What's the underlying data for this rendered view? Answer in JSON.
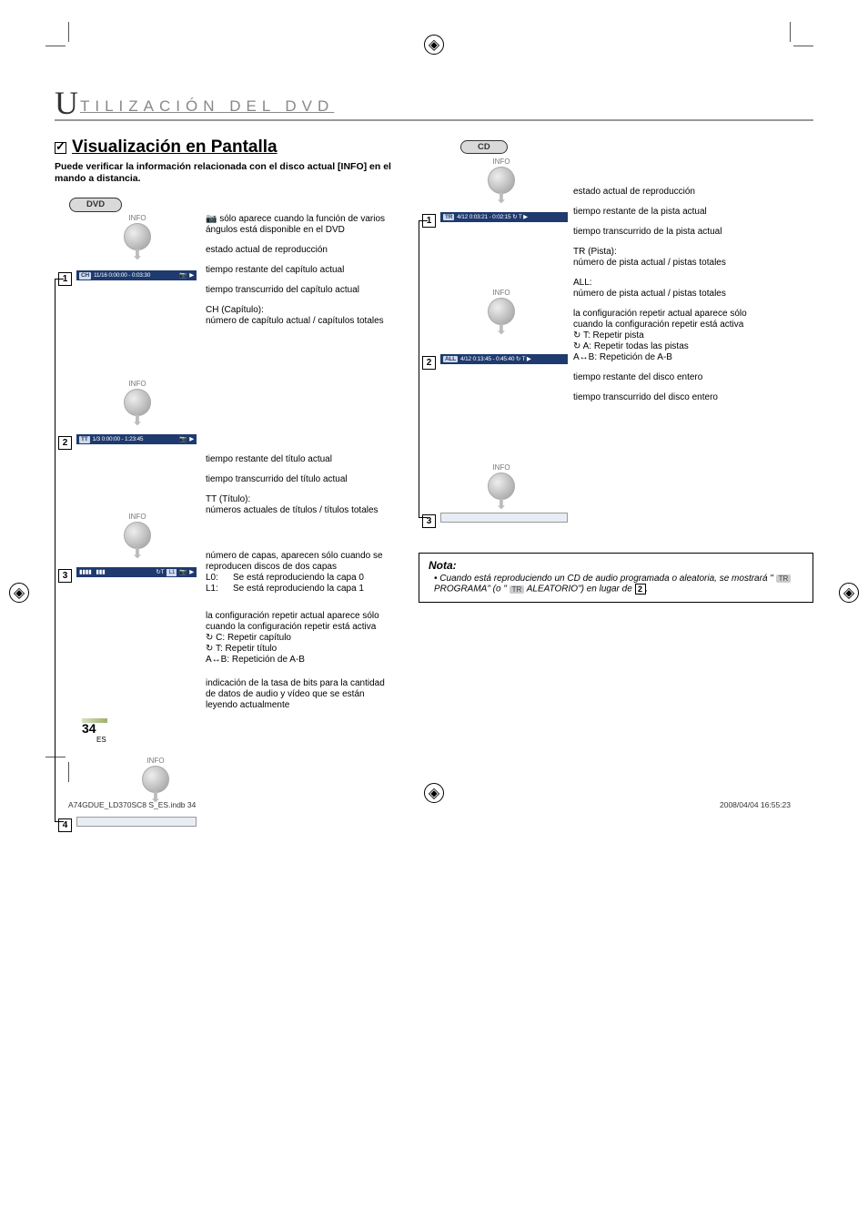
{
  "section_title_first": "U",
  "section_title_rest": "TILIZACIÓN   DEL   DVD",
  "subsection": "Visualización en Pantalla",
  "intro_pre": "Puede verificar la información relacionada con el disco actual ",
  "intro_key": "[INFO]",
  "intro_post": " en el mando a distancia.",
  "dvd_label": "DVD",
  "cd_label": "CD",
  "info_label": "INFO",
  "dvd": {
    "osd1": {
      "tag": "CH",
      "text": "11/16  0:00:00  -  0:03:30"
    },
    "osd2": {
      "tag": "TT",
      "text": "1/3   0:00:00  -  1:23:45"
    },
    "c_angle": "sólo aparece cuando la función de varios ángulos está disponible en el DVD",
    "c_status": "estado actual de reproducción",
    "c_ch_remain": "tiempo restante del capítulo actual",
    "c_ch_elapsed": "tiempo transcurrido del capítulo actual",
    "c_ch_title": "CH (Capítulo):",
    "c_ch_body": "número de capítulo actual / capítulos totales",
    "c_tt_remain": "tiempo restante del título actual",
    "c_tt_elapsed": "tiempo transcurrido del título actual",
    "c_tt_title": "TT (Título):",
    "c_tt_body": "números actuales de títulos / títulos totales",
    "c_layer_head": "número de capas, aparecen sólo cuando se reproducen discos de dos capas",
    "c_layer_l0k": "L0:",
    "c_layer_l0v": "Se está reproduciendo la capa 0",
    "c_layer_l1k": "L1:",
    "c_layer_l1v": "Se está reproduciendo la capa 1",
    "c_repeat_head": "la configuración repetir actual aparece sólo cuando la configuración repetir está activa",
    "c_repeat_c": "C:   Repetir capítulo",
    "c_repeat_t": "T:   Repetir título",
    "c_repeat_ab": "A↔B: Repetición de A-B",
    "c_bitrate": "indicación de la tasa de bits para la cantidad de datos de audio y vídeo que se están leyendo actualmente"
  },
  "cd": {
    "osd1": {
      "tag": "TR",
      "text": "4/12  0:03:21  -  0:02:15  ↻ T  ▶"
    },
    "osd2": {
      "tag": "ALL",
      "text": "4/12  0:13:45  -  0:45:40  ↻ T  ▶"
    },
    "c_status": "estado actual de reproducción",
    "c_tr_remain": "tiempo restante de la pista actual",
    "c_tr_elapsed": "tiempo transcurrido de la pista actual",
    "c_tr_title": "TR (Pista):",
    "c_tr_body": "número de pista actual / pistas totales",
    "c_all_title": "ALL:",
    "c_all_body": "número de pista actual / pistas totales",
    "c_repeat_head": "la configuración repetir actual aparece sólo cuando la configuración repetir está activa",
    "c_repeat_t": "T:   Repetir pista",
    "c_repeat_a": "A:   Repetir todas las pistas",
    "c_repeat_ab": "A↔B: Repetición de A-B",
    "c_disc_remain": "tiempo restante del disco entero",
    "c_disc_elapsed": "tiempo transcurrido del disco entero"
  },
  "note_title": "Nota:",
  "note_body_1": "Cuando está reproduciendo un CD de audio programada o aleatoria, se mostrará \" ",
  "note_prog": " PROGRAMA\" (o \" ",
  "note_aleat": " ALEATORIO\") en lugar de ",
  "note_ref_num": "2",
  "note_end": ".",
  "tr_pill": "TR",
  "page_number": "34",
  "page_lang": "ES",
  "footer_left": "A74GDUE_LD370SC8 S_ES.indb   34",
  "footer_right": "2008/04/04   16:55:23"
}
